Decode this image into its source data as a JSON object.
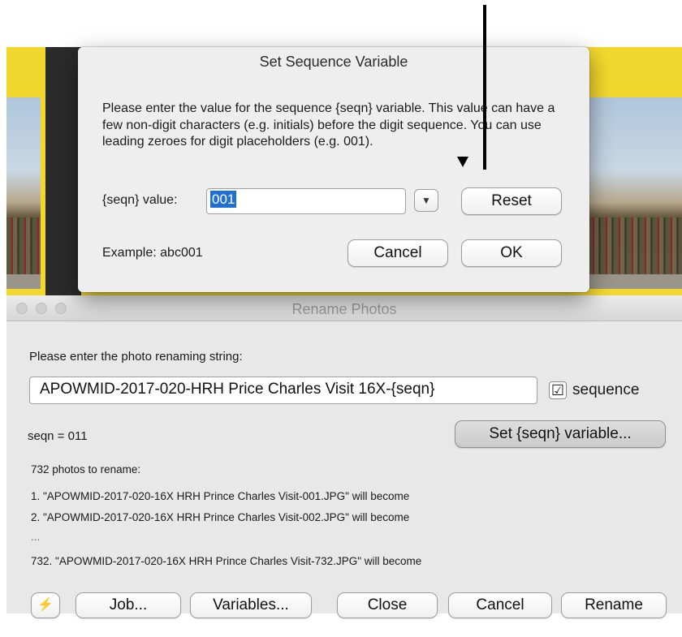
{
  "main_window": {
    "title": "Rename Photos",
    "prompt": "Please enter the photo renaming string:",
    "rename_string": "APOWMID-2017-020-HRH Price Charles Visit 16X-{seqn}",
    "sequence_checkbox": {
      "checked": true,
      "mark": "☑",
      "label": "sequence"
    },
    "seqn_status": "seqn = 011",
    "set_seqn_button": "Set {seqn} variable...",
    "count_text": "732 photos to rename:",
    "preview": [
      "1.  \"APOWMID-2017-020-16X HRH Prince Charles Visit-001.JPG\" will become",
      "2.  \"APOWMID-2017-020-16X HRH Prince Charles Visit-002.JPG\" will become",
      "...",
      "732.  \"APOWMID-2017-020-16X HRH Prince Charles Visit-732.JPG\" will become"
    ],
    "buttons": {
      "lightning": "⚡",
      "job": "Job...",
      "variables": "Variables...",
      "close": "Close",
      "cancel": "Cancel",
      "rename": "Rename"
    }
  },
  "dialog": {
    "title": "Set Sequence Variable",
    "message": "Please enter the value for the sequence {seqn} variable.  This value can have a few non-digit characters (e.g. initials) before the digit sequence.  You can use leading zeroes for digit placeholders (e.g. 001).",
    "value_label": "{seqn} value:",
    "value": "001",
    "dropdown_glyph": "▼",
    "reset_button": "Reset",
    "example": "Example: abc001",
    "cancel_button": "Cancel",
    "ok_button": "OK"
  },
  "colors": {
    "background_yellow": "#f2d82e",
    "selection_blue": "#1f6fd6",
    "window_gray": "#e8e8e8"
  }
}
